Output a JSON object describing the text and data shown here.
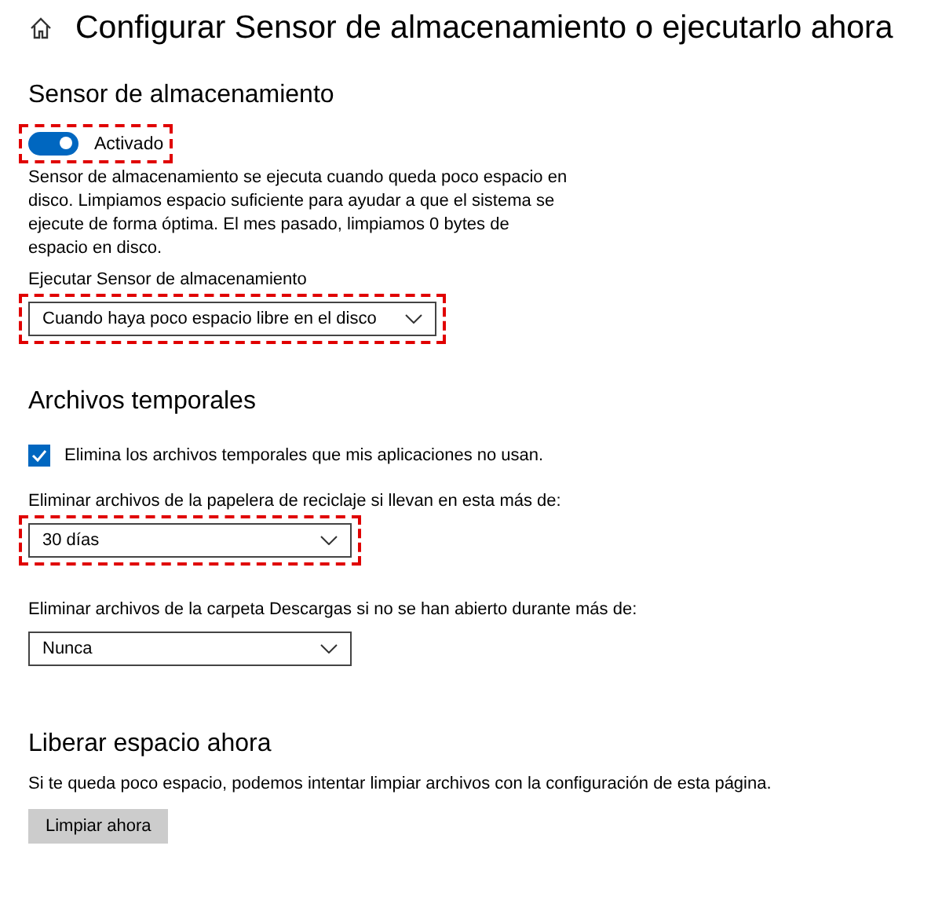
{
  "header": {
    "title": "Configurar Sensor de almacenamiento o ejecutarlo ahora"
  },
  "sections": [
    {
      "heading": "Sensor de almacenamiento",
      "items": [
        {
          "kind": "toggle",
          "on": true,
          "label": "Activado",
          "highlighted": true
        },
        {
          "kind": "paragraph",
          "text": "Sensor de almacenamiento se ejecuta cuando queda poco espacio en disco. Limpiamos espacio suficiente para ayudar a que el sistema se ejecute de forma óptima. El mes pasado, limpiamos 0 bytes de espacio en disco."
        },
        {
          "kind": "dropdown",
          "label": "Ejecutar Sensor de almacenamiento",
          "value": "Cuando haya poco espacio libre en el disco",
          "highlighted": true
        }
      ]
    },
    {
      "heading": "Archivos temporales",
      "items": [
        {
          "kind": "checkbox",
          "checked": true,
          "label": "Elimina los archivos temporales que mis aplicaciones no usan."
        },
        {
          "kind": "dropdown",
          "label": "Eliminar archivos de la papelera de reciclaje si llevan en esta más de:",
          "value": "30 días",
          "highlighted": true
        },
        {
          "kind": "dropdown",
          "label": "Eliminar archivos de la carpeta Descargas si no se han abierto durante más de:",
          "value": "Nunca",
          "highlighted": false
        }
      ]
    },
    {
      "heading": "Liberar espacio ahora",
      "items": [
        {
          "kind": "paragraph",
          "text": "Si te queda poco espacio, podemos intentar limpiar archivos con la configuración de esta página."
        },
        {
          "kind": "button",
          "label": "Limpiar ahora"
        }
      ]
    }
  ]
}
